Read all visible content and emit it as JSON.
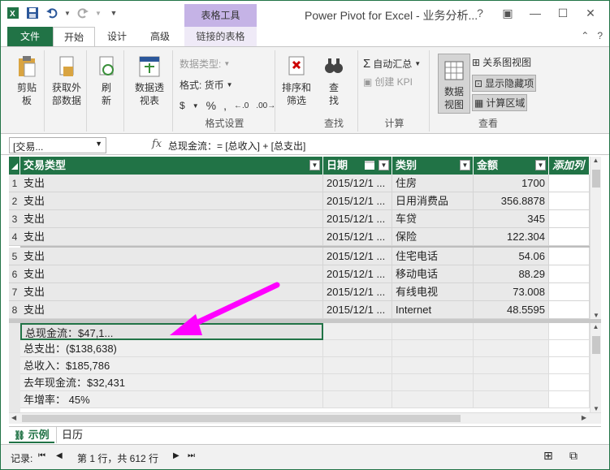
{
  "window": {
    "title": "Power Pivot for Excel - 业务分析...",
    "contextual_group": "表格工具"
  },
  "tabs": {
    "file": "文件",
    "home": "开始",
    "design": "设计",
    "advanced": "高级",
    "linked_table": "链接的表格"
  },
  "ribbon": {
    "paste": "剪贴\n板",
    "get_external": "获取外\n部数据",
    "refresh": "刷\n新",
    "pivot": "数据透\n视表",
    "data_type_label": "数据类型:",
    "format_label": "格式: 货币",
    "format_group_label": "格式设置",
    "sort_filter": "排序和\n筛选",
    "find": "查\n找",
    "find_group_label": "查找",
    "autosum": "自动汇总",
    "create_kpi": "创建 KPI",
    "calc_group_label": "计算",
    "data_view": "数据\n视图",
    "diagram_view": "关系图视图",
    "show_hidden": "显示隐藏项",
    "calc_area": "计算区域",
    "view_group_label": "查看",
    "dollar": "$",
    "percent": "%",
    "comma": ","
  },
  "formula_bar": {
    "name_box": "[交易...",
    "fx": "fx",
    "formula": "总现金流：= [总收入] + [总支出]"
  },
  "table": {
    "columns": [
      "交易类型",
      "日期",
      "类别",
      "金额",
      "添加列"
    ],
    "rows": [
      {
        "n": "1",
        "type": "支出",
        "date": "2015/12/1 ...",
        "category": "住房",
        "amount": "1700"
      },
      {
        "n": "2",
        "type": "支出",
        "date": "2015/12/1 ...",
        "category": "日用消费品",
        "amount": "356.8878"
      },
      {
        "n": "3",
        "type": "支出",
        "date": "2015/12/1 ...",
        "category": "车贷",
        "amount": "345"
      },
      {
        "n": "4",
        "type": "支出",
        "date": "2015/12/1 ...",
        "category": "保险",
        "amount": "122.304"
      },
      {
        "n": "5",
        "type": "支出",
        "date": "2015/12/1 ...",
        "category": "住宅电话",
        "amount": "54.06"
      },
      {
        "n": "6",
        "type": "支出",
        "date": "2015/12/1 ...",
        "category": "移动电话",
        "amount": "88.29"
      },
      {
        "n": "7",
        "type": "支出",
        "date": "2015/12/1 ...",
        "category": "有线电视",
        "amount": "73.008"
      },
      {
        "n": "8",
        "type": "支出",
        "date": "2015/12/1 ...",
        "category": "Internet",
        "amount": "48.5595"
      }
    ]
  },
  "measures": [
    "总现金流：$47,1...",
    "总支出：($138,638)",
    "总收入：$185,786",
    "去年现金流：$32,431",
    "年增率： 45%"
  ],
  "sheets": {
    "active": "示例",
    "other": "日历"
  },
  "status": {
    "record_label": "记录:",
    "position": "第 1 行，共 612 行"
  },
  "colors": {
    "accent": "#217346",
    "arrow": "#ff00ff"
  }
}
